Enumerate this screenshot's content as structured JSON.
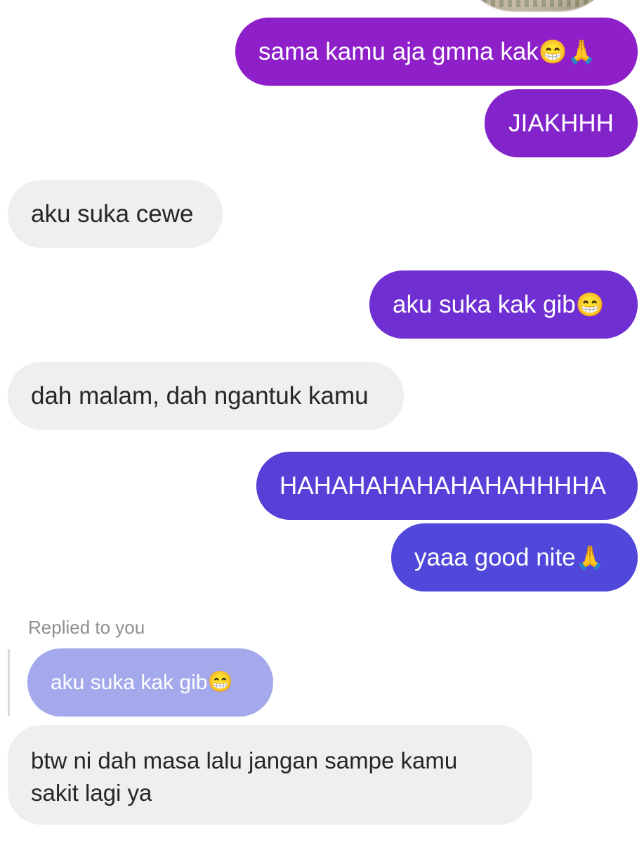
{
  "messages": [
    {
      "direction": "sent",
      "text": "sama kamu aja gmna kak",
      "emoji": "😁🙏"
    },
    {
      "direction": "sent",
      "text": "JIAKHHH",
      "emoji": ""
    },
    {
      "direction": "received",
      "text": "aku suka cewe",
      "emoji": ""
    },
    {
      "direction": "sent",
      "text": "aku suka kak gib",
      "emoji": "😁"
    },
    {
      "direction": "received",
      "text": "dah malam, dah ngantuk kamu",
      "emoji": ""
    },
    {
      "direction": "sent",
      "text": "HAHAHAHAHAHAHAHHHHA",
      "emoji": ""
    },
    {
      "direction": "sent",
      "text": "yaaa good nite",
      "emoji": "🙏"
    }
  ],
  "reply": {
    "label": "Replied to you",
    "quoted_text": "aku suka kak gib",
    "quoted_emoji": "😁",
    "message_line1": "btw ni dah masa lalu jangan sampe kamu",
    "message_line2": "sakit lagi ya"
  },
  "colors": {
    "sent_gradient_top": "#8e1fc9",
    "sent_gradient_bottom": "#4f4fdb",
    "received_bg": "#efefef",
    "quoted_bg": "#a4a9ec"
  }
}
